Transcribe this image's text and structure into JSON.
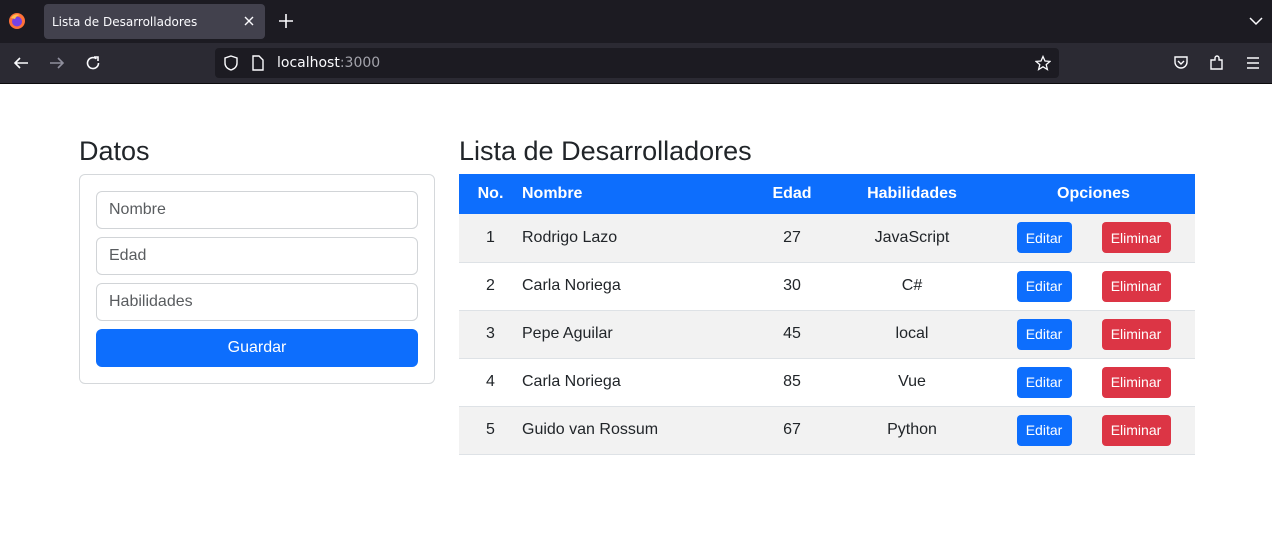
{
  "browser": {
    "tab_title": "Lista de Desarrolladores",
    "url_host": "localhost",
    "url_port": ":3000"
  },
  "form": {
    "heading": "Datos",
    "name_placeholder": "Nombre",
    "age_placeholder": "Edad",
    "skills_placeholder": "Habilidades",
    "save_label": "Guardar"
  },
  "list": {
    "heading": "Lista de Desarrolladores",
    "columns": [
      "No.",
      "Nombre",
      "Edad",
      "Habilidades",
      "Opciones"
    ],
    "edit_label": "Editar",
    "delete_label": "Eliminar",
    "rows": [
      {
        "no": "1",
        "name": "Rodrigo Lazo",
        "age": "27",
        "skills": "JavaScript"
      },
      {
        "no": "2",
        "name": "Carla Noriega",
        "age": "30",
        "skills": "C#"
      },
      {
        "no": "3",
        "name": "Pepe Aguilar",
        "age": "45",
        "skills": "local"
      },
      {
        "no": "4",
        "name": "Carla Noriega",
        "age": "85",
        "skills": "Vue"
      },
      {
        "no": "5",
        "name": "Guido van Rossum",
        "age": "67",
        "skills": "Python"
      }
    ]
  },
  "colors": {
    "primary": "#0d6efd",
    "danger": "#dc3545",
    "stripe": "#f2f2f2"
  }
}
